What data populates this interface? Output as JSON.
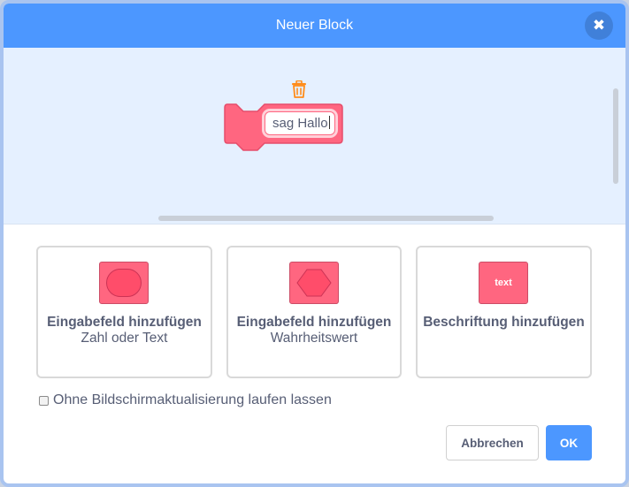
{
  "dialog": {
    "title": "Neuer Block",
    "close_symbol": "✖"
  },
  "workspace": {
    "block_text": "sag Hallo",
    "block_color": "#ff6680",
    "trash_icon": "trash-icon"
  },
  "options": [
    {
      "title": "Eingabefeld hinzufügen",
      "subtitle": "Zahl oder Text",
      "icon": "number-text-input-icon"
    },
    {
      "title": "Eingabefeld hinzufügen",
      "subtitle": "Wahrheitswert",
      "icon": "boolean-input-icon"
    },
    {
      "title": "Beschriftung hinzufügen",
      "subtitle": "",
      "icon": "label-text-icon",
      "icon_text": "text"
    }
  ],
  "run_without_refresh": {
    "label": "Ohne Bildschirmaktualisierung laufen lassen",
    "checked": false
  },
  "buttons": {
    "cancel": "Abbrechen",
    "ok": "OK"
  },
  "colors": {
    "accent": "#4c97ff",
    "block": "#ff6680",
    "text": "#575e75"
  }
}
